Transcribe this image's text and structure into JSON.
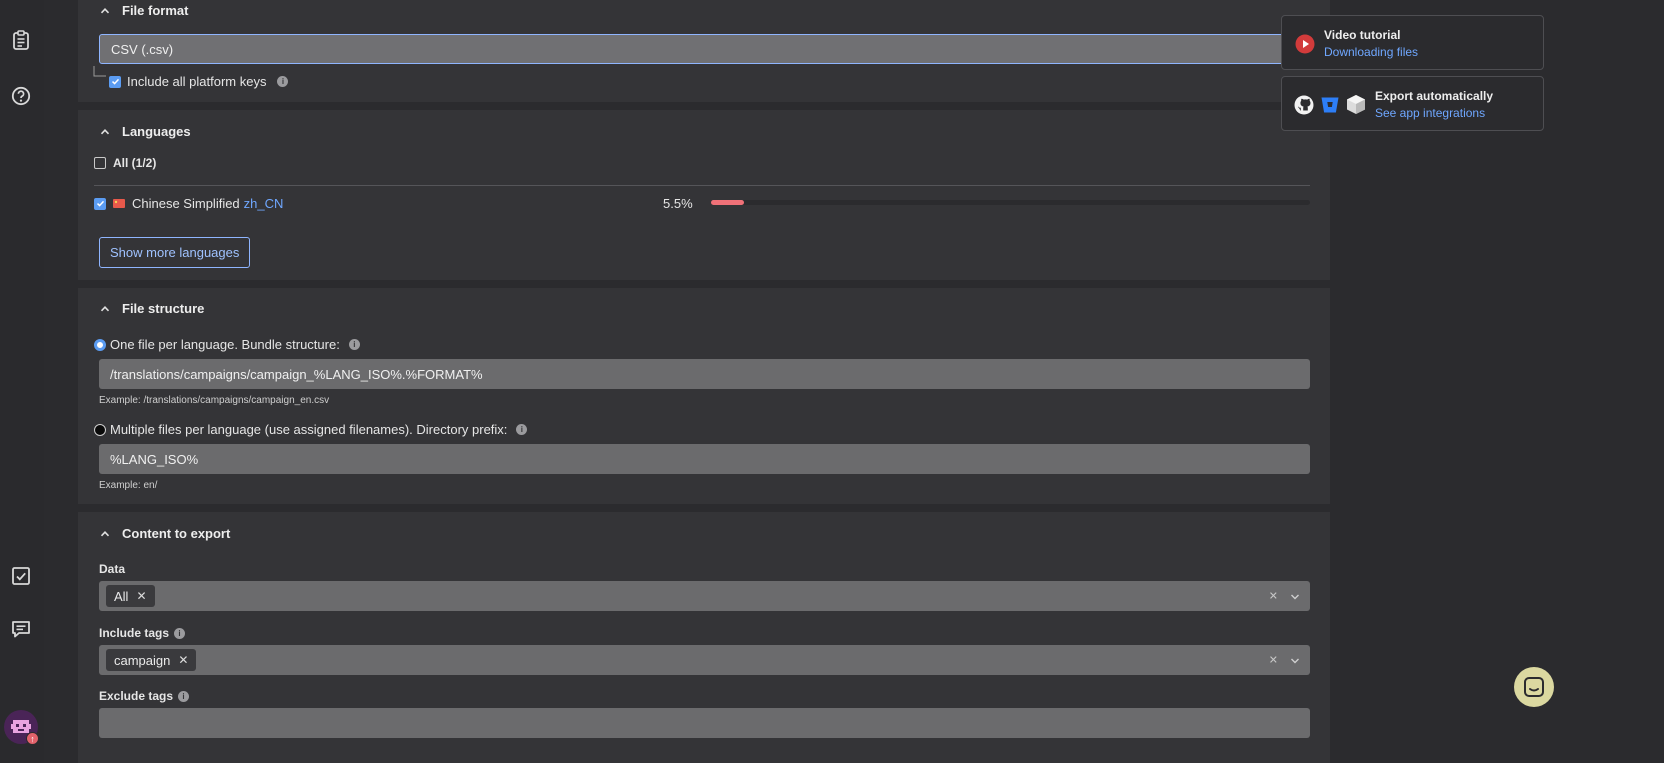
{
  "file_format": {
    "title": "File format",
    "selected": "CSV (.csv)",
    "include_keys_label": "Include all platform keys"
  },
  "languages": {
    "title": "Languages",
    "all_label": "All (1/2)",
    "items": [
      {
        "name": "Chinese Simplified",
        "code": "zh_CN",
        "percent_label": "5.5%",
        "progress": 0.055
      }
    ],
    "show_more_label": "Show more languages"
  },
  "file_structure": {
    "title": "File structure",
    "option1_label": "One file per language. Bundle structure:",
    "option1_value": "/translations/campaigns/campaign_%LANG_ISO%.%FORMAT%",
    "option1_example": "Example: /translations/campaigns/campaign_en.csv",
    "option2_label": "Multiple files per language (use assigned filenames). Directory prefix:",
    "option2_value": "%LANG_ISO%",
    "option2_example": "Example: en/"
  },
  "content_export": {
    "title": "Content to export",
    "data_label": "Data",
    "data_chips": [
      "All"
    ],
    "include_tags_label": "Include tags",
    "include_tags_chips": [
      "campaign"
    ],
    "exclude_tags_label": "Exclude tags"
  },
  "sidebar_cards": {
    "video": {
      "title": "Video tutorial",
      "link": "Downloading files"
    },
    "export": {
      "title": "Export automatically",
      "link": "See app integrations"
    }
  },
  "colors": {
    "accent": "#5b9cf2",
    "link": "#6fa7ff",
    "progress": "#f07178",
    "chat": "#dbd8a0"
  }
}
